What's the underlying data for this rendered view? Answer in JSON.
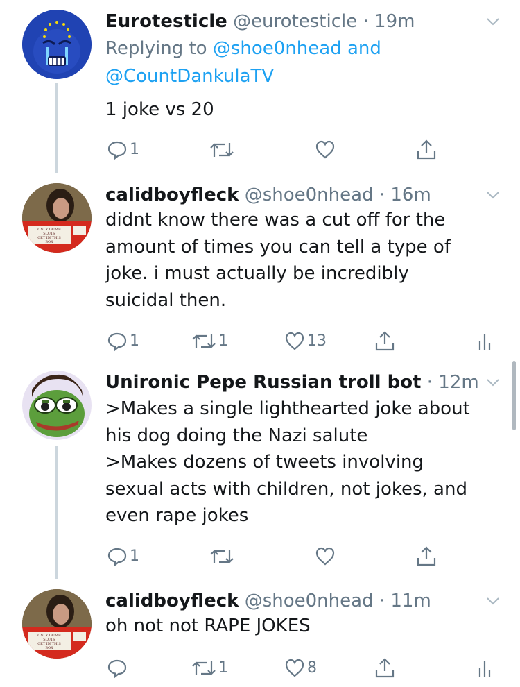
{
  "tweets": [
    {
      "name": "Eurotesticle",
      "handle": "@eurotesticle",
      "dot": "·",
      "time": "19m",
      "replying_prefix": "Replying to ",
      "replying_user1": "@shoe0nhead",
      "replying_and": " and",
      "replying_user2": "@CountDankulaTV",
      "text": "1 joke vs 20",
      "reply_count": "1",
      "retweet_count": "",
      "like_count": ""
    },
    {
      "name": "calidboyfleck",
      "handle": "@shoe0nhead",
      "dot": "·",
      "time": "16m",
      "text": "didnt know there was a cut off for the\namount of times you can tell a type of\njoke. i must actually be incredibly\nsuicidal then.",
      "reply_count": "1",
      "retweet_count": "1",
      "like_count": "13",
      "avatar_sign": "ONLY DUMB\nSLUTS\nGET IN THIS\nBOX"
    },
    {
      "name": "Unironic Pepe Russian troll bot",
      "handle": "",
      "dot": "·",
      "time": "12m",
      "text": ">Makes a single lighthearted joke about\nhis dog doing the Nazi salute\n>Makes dozens of tweets involving\nsexual acts with children, not jokes, and\neven rape jokes",
      "reply_count": "1",
      "retweet_count": "",
      "like_count": ""
    },
    {
      "name": "calidboyfleck",
      "handle": "@shoe0nhead",
      "dot": "·",
      "time": "11m",
      "text": "oh not not RAPE JOKES",
      "reply_count": "",
      "retweet_count": "1",
      "like_count": "8",
      "avatar_sign": "ONLY DUMB\nSLUTS\nGET IN THIS\nBOX"
    }
  ],
  "icons": {
    "reply": "reply-icon",
    "retweet": "retweet-icon",
    "like": "heart-icon",
    "share": "share-icon",
    "analytics": "analytics-icon",
    "more": "chevron-down-icon"
  },
  "colors": {
    "text": "#14171a",
    "muted": "#657786",
    "link": "#1da1f2",
    "thread_line": "#ccd6dd"
  }
}
